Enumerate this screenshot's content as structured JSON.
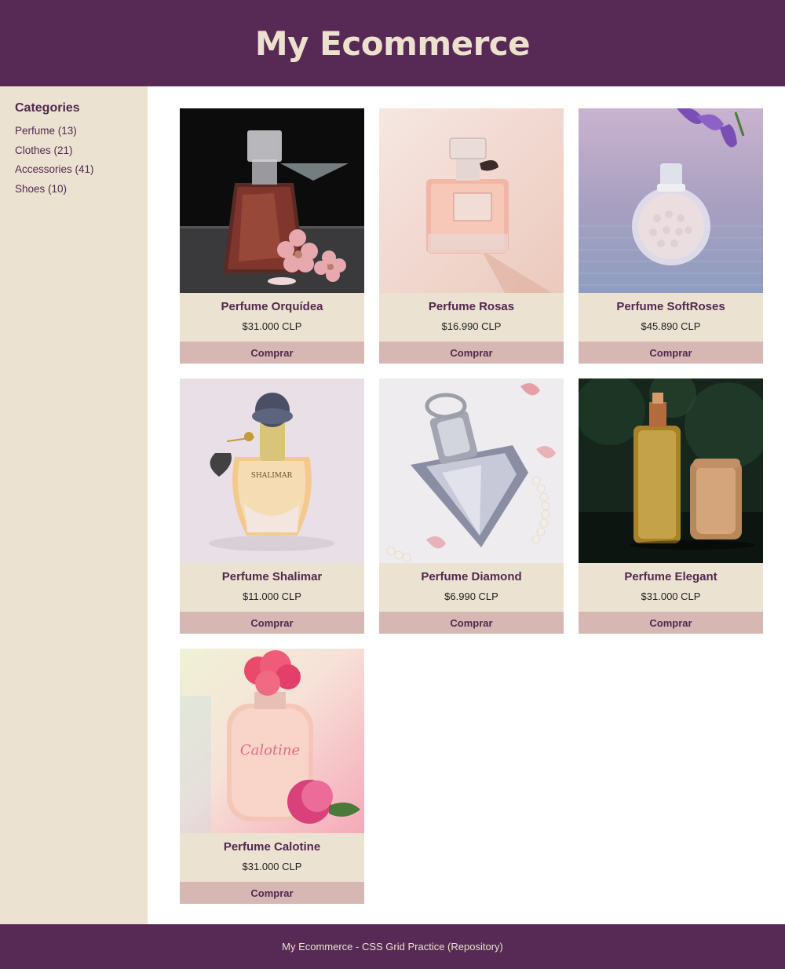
{
  "header": {
    "title": "My Ecommerce"
  },
  "sidebar": {
    "heading": "Categories",
    "items": [
      {
        "label": "Perfume (13)"
      },
      {
        "label": "Clothes (21)"
      },
      {
        "label": "Accessories (41)"
      },
      {
        "label": "Shoes (10)"
      }
    ]
  },
  "products": [
    {
      "name": "Perfume Orquídea",
      "price": "$31.000 CLP",
      "button": "Comprar"
    },
    {
      "name": "Perfume Rosas",
      "price": "$16.990 CLP",
      "button": "Comprar"
    },
    {
      "name": "Perfume SoftRoses",
      "price": "$45.890 CLP",
      "button": "Comprar"
    },
    {
      "name": "Perfume Shalimar",
      "price": "$11.000 CLP",
      "button": "Comprar",
      "bottle_text": "SHALIMAR"
    },
    {
      "name": "Perfume Diamond",
      "price": "$6.990 CLP",
      "button": "Comprar"
    },
    {
      "name": "Perfume Elegant",
      "price": "$31.000 CLP",
      "button": "Comprar"
    },
    {
      "name": "Perfume Calotine",
      "price": "$31.000 CLP",
      "button": "Comprar",
      "bottle_text": "Calotine"
    }
  ],
  "footer": {
    "text": "My Ecommerce - CSS Grid Practice (Repository)"
  },
  "colors": {
    "primary": "#572a56",
    "sidebar_bg": "#ebe2d1",
    "button_bg": "#d7b7b3",
    "header_text": "#ece1cd"
  }
}
